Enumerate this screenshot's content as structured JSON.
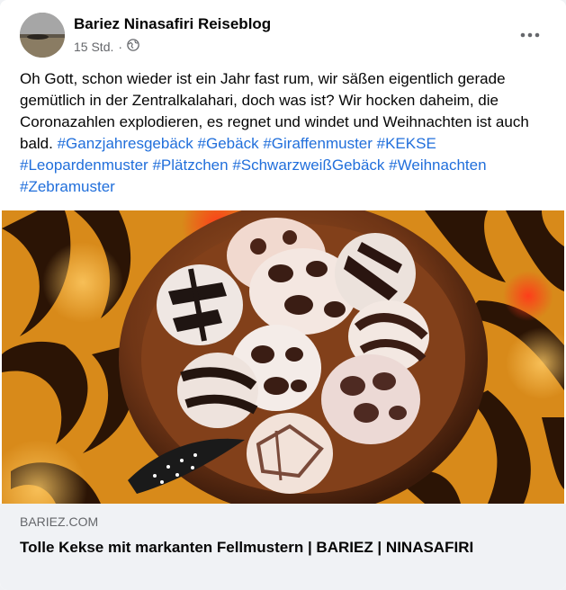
{
  "post": {
    "author": "Bariez Ninasafiri Reiseblog",
    "timestamp": "15 Std.",
    "separator": "·",
    "privacy_icon": "globe-icon",
    "more_icon": "more-horizontal-icon",
    "text": "Oh Gott, schon wieder ist ein Jahr fast rum, wir säßen eigentlich gerade gemütlich in der Zentralkalahari, doch was ist? Wir hocken daheim, die Coronazahlen explodieren, es regnet und windet und Weihnachten ist auch bald. ",
    "hashtags": [
      "#Ganzjahresgebäck",
      "#Gebäck",
      "#Giraffenmuster",
      "#KEKSE",
      "#Leopardenmuster",
      "#Plätzchen",
      "#SchwarzweißGebäck",
      "#Weihnachten",
      "#Zebramuster"
    ]
  },
  "link_preview": {
    "domain": "BARIEZ.COM",
    "title": "Tolle Kekse mit markanten Fellmustern | BARIEZ | NINASAFIRI"
  },
  "colors": {
    "hashtag": "#216fdb",
    "text": "#050505",
    "secondary": "#65676b",
    "preview_bg": "#f0f2f5"
  }
}
